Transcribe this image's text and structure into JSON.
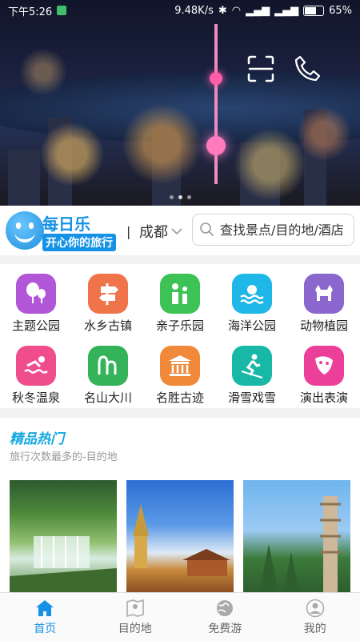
{
  "status": {
    "time": "下午5:26",
    "speed": "9.48K/s",
    "battery": "65%"
  },
  "header": {
    "city": "成都",
    "divider": "|",
    "search_placeholder": "查找景点/目的地/酒店"
  },
  "logo": {
    "title": "每日乐",
    "slogan": "开心你的旅行"
  },
  "categories": [
    {
      "label": "主题公园",
      "icon": "balloon-icon",
      "color": "#b256d8"
    },
    {
      "label": "水乡古镇",
      "icon": "signpost-icon",
      "color": "#f0744a"
    },
    {
      "label": "亲子乐园",
      "icon": "family-icon",
      "color": "#3cc255"
    },
    {
      "label": "海洋公园",
      "icon": "sun-sea-icon",
      "color": "#1fb6e8"
    },
    {
      "label": "动物植园",
      "icon": "animal-icon",
      "color": "#8b66cc"
    },
    {
      "label": "秋冬温泉",
      "icon": "swim-icon",
      "color": "#f04d8c"
    },
    {
      "label": "名山大川",
      "icon": "mountain-icon",
      "color": "#35b35a"
    },
    {
      "label": "名胜古迹",
      "icon": "temple-icon",
      "color": "#f08a3a"
    },
    {
      "label": "滑雪戏雪",
      "icon": "ski-icon",
      "color": "#19b8a6"
    },
    {
      "label": "演出表演",
      "icon": "mask-icon",
      "color": "#ec3f9a"
    }
  ],
  "hot": {
    "title": "精品热门",
    "subtitle": "旅行次数最多的-目的地"
  },
  "tabs": [
    {
      "label": "首页",
      "icon": "home-icon",
      "active": true
    },
    {
      "label": "目的地",
      "icon": "map-pin-icon",
      "active": false
    },
    {
      "label": "免费游",
      "icon": "globe-icon",
      "active": false
    },
    {
      "label": "我的",
      "icon": "user-icon",
      "active": false
    }
  ],
  "colors": {
    "accent": "#1592e6",
    "hot_title": "#12a8e0"
  }
}
